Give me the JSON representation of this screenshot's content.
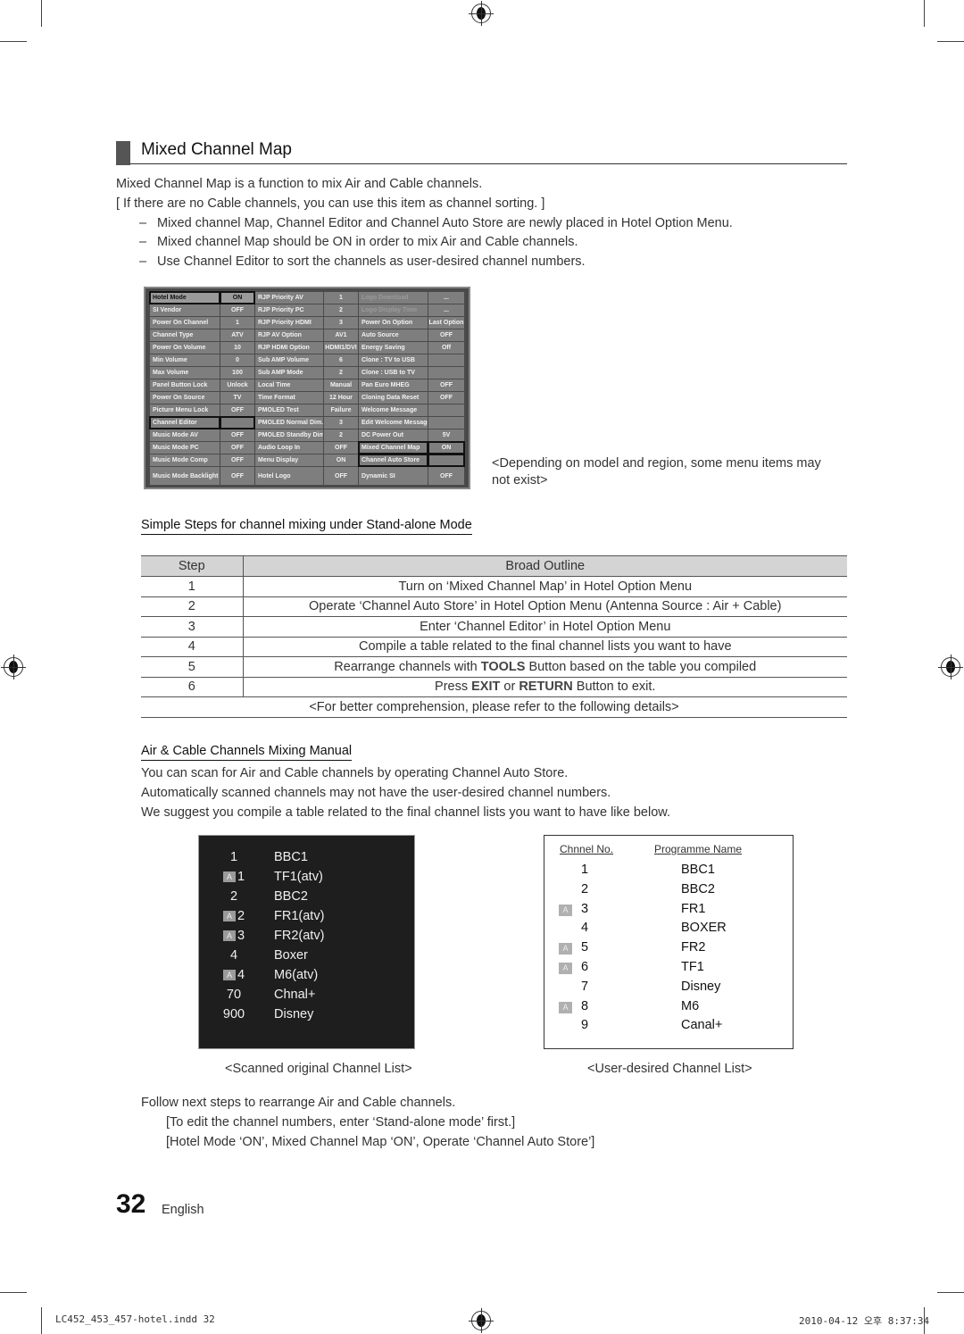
{
  "section": {
    "title": "Mixed Channel Map",
    "intro": [
      "Mixed Channel Map is a function to mix Air and Cable channels.",
      "[ If there are no Cable channels, you can use this item as channel sorting. ]"
    ],
    "bullets": [
      "Mixed channel Map, Channel Editor and Channel Auto Store are newly placed in Hotel Option Menu.",
      "Mixed channel Map should be ON in order to mix Air and Cable channels.",
      "Use Channel Editor to sort the channels as user-desired channel numbers."
    ],
    "bullet_marker": "–"
  },
  "hotel_menu": {
    "rows": [
      [
        [
          "Hotel Mode",
          "ON"
        ],
        [
          "RJP Priority AV",
          "1"
        ],
        [
          "Logo Download",
          "..."
        ]
      ],
      [
        [
          "SI Vendor",
          "OFF"
        ],
        [
          "RJP Priority PC",
          "2"
        ],
        [
          "Logo Display Time",
          "..."
        ]
      ],
      [
        [
          "Power On Channel",
          "1"
        ],
        [
          "RJP Priority HDMI",
          "3"
        ],
        [
          "Power On Option",
          "Last Option"
        ]
      ],
      [
        [
          "Channel Type",
          "ATV"
        ],
        [
          "RJP AV Option",
          "AV1"
        ],
        [
          "Auto Source",
          "OFF"
        ]
      ],
      [
        [
          "Power On Volume",
          "10"
        ],
        [
          "RJP HDMI Option",
          "HDMI1/DVI"
        ],
        [
          "Energy Saving",
          "Off"
        ]
      ],
      [
        [
          "Min Volume",
          "0"
        ],
        [
          "Sub AMP Volume",
          "6"
        ],
        [
          "Clone : TV to USB",
          ""
        ]
      ],
      [
        [
          "Max Volume",
          "100"
        ],
        [
          "Sub AMP Mode",
          "2"
        ],
        [
          "Clone : USB to TV",
          ""
        ]
      ],
      [
        [
          "Panel Button Lock",
          "Unlock"
        ],
        [
          "Local Time",
          "Manual"
        ],
        [
          "Pan Euro MHEG",
          "OFF"
        ]
      ],
      [
        [
          "Power On Source",
          "TV"
        ],
        [
          "Time Format",
          "12 Hour"
        ],
        [
          "Cloning Data Reset",
          "OFF"
        ]
      ],
      [
        [
          "Picture Menu Lock",
          "OFF"
        ],
        [
          "PMOLED Test",
          "Failure"
        ],
        [
          "Welcome Message",
          ""
        ]
      ],
      [
        [
          "Channel Editor",
          ""
        ],
        [
          "PMOLED Normal Dim.",
          "3"
        ],
        [
          "Edit Welcome Message",
          ""
        ]
      ],
      [
        [
          "Music Mode AV",
          "OFF"
        ],
        [
          "PMOLED Standby Dim.",
          "2"
        ],
        [
          "DC Power Out",
          "5V"
        ]
      ],
      [
        [
          "Music Mode PC",
          "OFF"
        ],
        [
          "Audio Loop In",
          "OFF"
        ],
        [
          "Mixed Channel Map",
          "ON"
        ]
      ],
      [
        [
          "Music Mode Comp",
          "OFF"
        ],
        [
          "Menu Display",
          "ON"
        ],
        [
          "Channel Auto Store",
          ""
        ]
      ],
      [
        [
          "Music Mode Backlight",
          "OFF"
        ],
        [
          "Hotel Logo",
          "OFF"
        ],
        [
          "Dynamic SI",
          "OFF"
        ]
      ]
    ],
    "note": "<Depending on model and region, some  menu items may not exist>"
  },
  "steps": {
    "heading": "Simple Steps for channel mixing under Stand-alone Mode",
    "col_step": "Step",
    "col_outline": "Broad Outline",
    "rows": [
      {
        "step": "1",
        "text": "Turn on ‘Mixed Channel Map’ in Hotel Option Menu"
      },
      {
        "step": "2",
        "text": "Operate ‘Channel Auto Store’ in Hotel Option Menu (Antenna Source : Air + Cable)"
      },
      {
        "step": "3",
        "text": "Enter ‘Channel Editor’ in Hotel Option Menu"
      },
      {
        "step": "4",
        "text": "Compile a table related to the final channel lists you want to have"
      },
      {
        "step": "5",
        "pre": "Rearrange channels with ",
        "bold": "TOOLS",
        "post": " Button based on the table you compiled"
      },
      {
        "step": "6",
        "pre": "Press ",
        "bold": "EXIT",
        "mid": " or ",
        "bold2": "RETURN",
        "post": " Button to exit."
      }
    ],
    "footer": "<For better comprehension, please refer to the following details>"
  },
  "mixing": {
    "heading": "Air & Cable Channels Mixing Manual",
    "lines": [
      "You can scan for Air and Cable channels by operating Channel Auto Store.",
      "Automatically scanned channels may not have the user-desired channel numbers.",
      "We suggest you compile a table related to the final channel lists you want to have like below."
    ]
  },
  "scanned_list": {
    "caption": "<Scanned original Channel List>",
    "badge": "A",
    "rows": [
      {
        "num": "1",
        "name": "BBC1",
        "analog": false
      },
      {
        "num": "1",
        "name": "TF1(atv)",
        "analog": true
      },
      {
        "num": "2",
        "name": "BBC2",
        "analog": false
      },
      {
        "num": "2",
        "name": "FR1(atv)",
        "analog": true
      },
      {
        "num": "3",
        "name": "FR2(atv)",
        "analog": true
      },
      {
        "num": "4",
        "name": "Boxer",
        "analog": false
      },
      {
        "num": "4",
        "name": "M6(atv)",
        "analog": true
      },
      {
        "num": "70",
        "name": "Chnal+",
        "analog": false
      },
      {
        "num": "900",
        "name": "Disney",
        "analog": false
      }
    ]
  },
  "desired_list": {
    "caption": "<User-desired Channel List>",
    "col_no": "Chnnel No.",
    "col_name": "Programme Name",
    "badge": "A",
    "rows": [
      {
        "num": "1",
        "name": "BBC1",
        "analog": false
      },
      {
        "num": "2",
        "name": "BBC2",
        "analog": false
      },
      {
        "num": "3",
        "name": "FR1",
        "analog": true
      },
      {
        "num": "4",
        "name": "BOXER",
        "analog": false
      },
      {
        "num": "5",
        "name": "FR2",
        "analog": true
      },
      {
        "num": "6",
        "name": "TF1",
        "analog": true
      },
      {
        "num": "7",
        "name": "Disney",
        "analog": false
      },
      {
        "num": "8",
        "name": "M6",
        "analog": true
      },
      {
        "num": "9",
        "name": "Canal+",
        "analog": false
      }
    ]
  },
  "follow": {
    "line": "Follow next steps to rearrange Air and Cable channels.",
    "sub": [
      "[To edit the channel numbers, enter ‘Stand-alone mode’ first.]",
      "[Hotel Mode ‘ON’, Mixed Channel Map ‘ON’, Operate ‘Channel Auto Store’]"
    ]
  },
  "page": {
    "number": "32",
    "language": "English",
    "footer_file": "LC452_453_457-hotel.indd   32",
    "footer_date": "2010-04-12   오후 8:37:34"
  }
}
